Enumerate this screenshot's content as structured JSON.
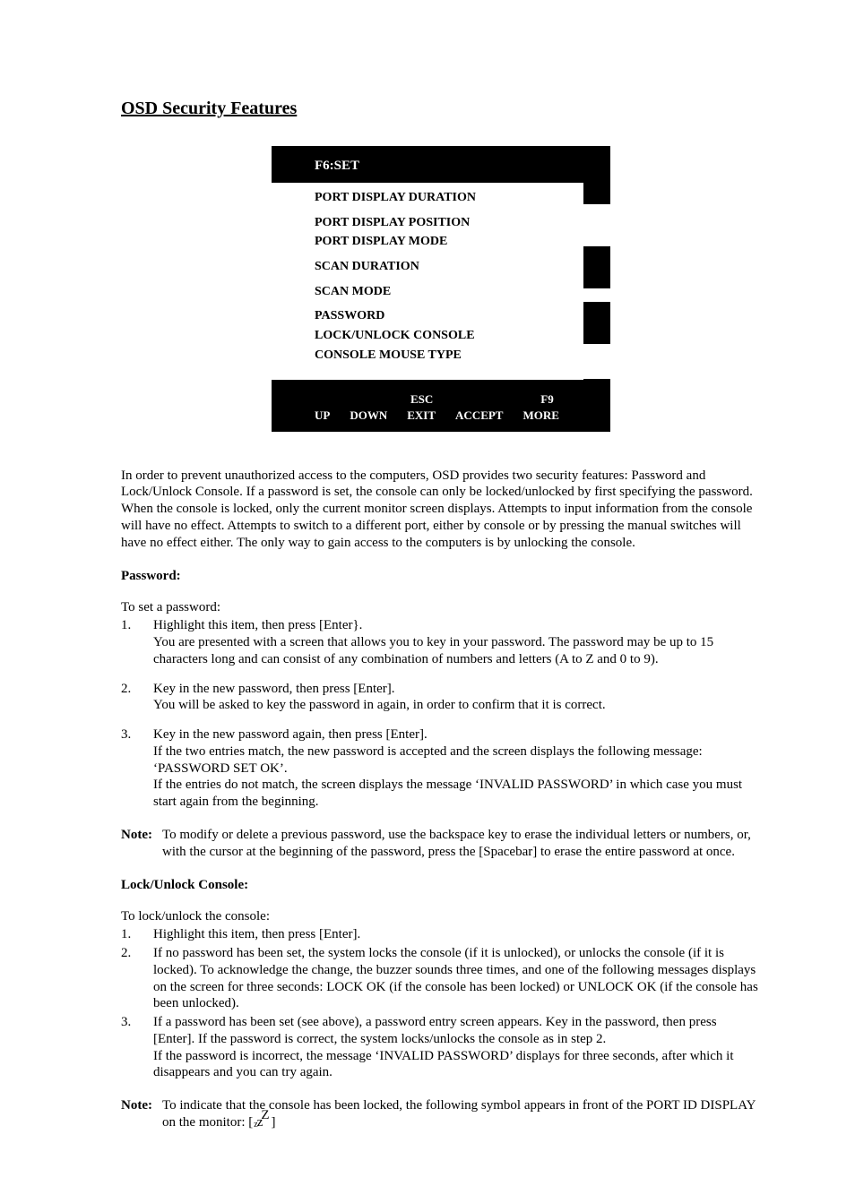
{
  "title": "OSD Security Features",
  "osd": {
    "header": "F6:SET",
    "items": [
      "PORT DISPLAY DURATION",
      "PORT DISPLAY POSITION",
      "PORT DISPLAY MODE",
      "SCAN DURATION",
      "SCAN MODE",
      "PASSWORD",
      "LOCK/UNLOCK CONSOLE",
      "CONSOLE MOUSE TYPE"
    ],
    "footer_top": {
      "esc": "ESC",
      "f9": "F9"
    },
    "footer_bottom": {
      "up": "UP",
      "down": "DOWN",
      "exit": "EXIT",
      "accept": "ACCEPT",
      "more": "MORE"
    }
  },
  "intro": "In order to prevent unauthorized access to the computers, OSD provides two security features:  Password and Lock/Unlock Console.  If a password is set, the console can only be locked/unlocked by first specifying the password.  When the console is locked, only the current monitor screen displays.  Attempts to input information from the console will have no effect.  Attempts to switch to a different port, either by console or by pressing the manual switches will have no effect either.  The only way to gain access to the computers is by unlocking the console.",
  "password": {
    "heading": "Password:",
    "lead": "To set a password:",
    "steps": [
      "Highlight this item, then press [Enter}.\nYou are presented with a screen that allows you to key in your password.  The password may be up to 15 characters long and can consist of any combination of numbers and letters (A to Z and 0 to 9).",
      "Key in the new password, then press [Enter].\nYou will be asked to key the password in again, in order to confirm that it is correct.",
      "Key in the new password again, then press [Enter].\nIf the two entries match, the new password is accepted and the screen displays the following message: ‘PASSWORD SET OK’.\nIf the entries do not match, the screen displays the message ‘INVALID PASSWORD’ in which case you must start again from the beginning."
    ],
    "note_label": "Note:",
    "note_text": "To modify or delete a previous password, use the backspace key to erase the individual letters or numbers, or, with the cursor at the beginning of the password, press the [Spacebar] to erase the entire password at once."
  },
  "lock": {
    "heading": "Lock/Unlock Console:",
    "lead": "To lock/unlock the console:",
    "steps": [
      "Highlight this item, then press [Enter].",
      "If no password has been set, the system locks the console (if it is unlocked), or unlocks the console (if it is locked).  To acknowledge the change, the buzzer sounds three times, and one of the following messages displays on the screen for three seconds:  LOCK OK (if the console has been locked) or UNLOCK OK (if the console has been unlocked).",
      "If a password has been set (see above), a password entry screen appears.  Key in the password, then press [Enter].  If the password is correct, the system locks/unlocks the console as in step 2.\nIf the password is incorrect, the message ‘INVALID PASSWORD’ displays for three seconds, after which it disappears and you can try again."
    ],
    "note_label": "Note:",
    "note_text_prefix": "To indicate that the console has been locked, the following symbol appears in front of the PORT ID DISPLAY on the monitor: [",
    "note_text_suffix": "]"
  }
}
